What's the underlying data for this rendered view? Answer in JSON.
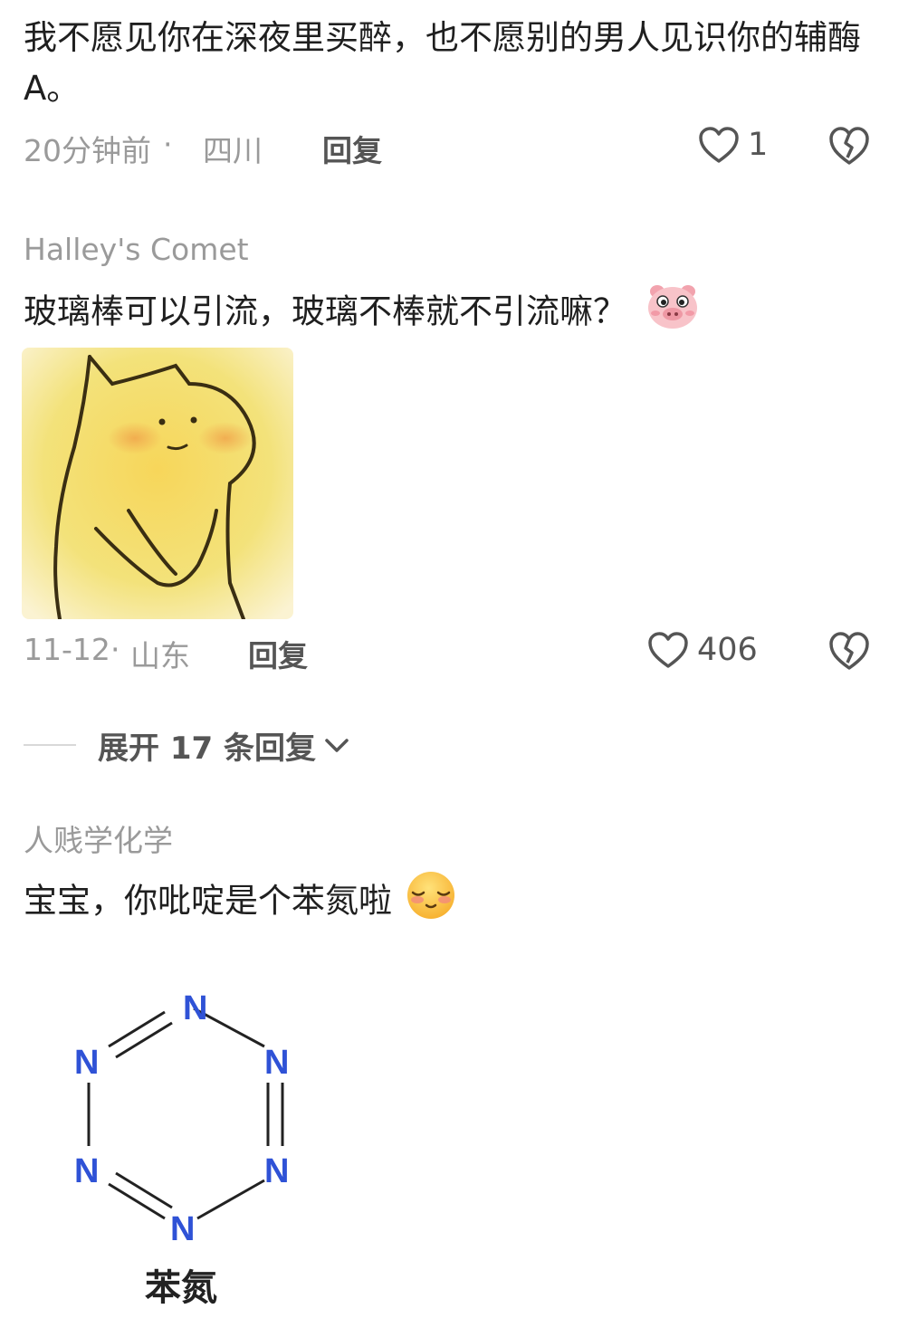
{
  "comments": [
    {
      "text": "我不愿见你在深夜里买醉，也不愿别的男人见识你的辅酶A。",
      "time": "20分钟前",
      "location": "四川",
      "reply_label": "回复",
      "likes": "1"
    },
    {
      "author": "Halley's Comet",
      "text": "玻璃棒可以引流，玻璃不棒就不引流嘛？",
      "emoji": "pig-face-emoji",
      "time": "11-12",
      "location": "山东",
      "reply_label": "回复",
      "likes": "406",
      "expand_label": "展开 17 条回复"
    },
    {
      "author": "人贱学化学",
      "text": "宝宝，你吡啶是个苯氮啦",
      "emoji": "blushing-smile-emoji",
      "image_atoms": [
        "N",
        "N",
        "N",
        "N",
        "N",
        "N"
      ],
      "image_caption": "苯氮"
    }
  ],
  "colors": {
    "primary_text": "#1f1f1f",
    "secondary_text": "#9a9a9a",
    "action_text": "#555555",
    "nitrogen_blue": "#2f52d6"
  }
}
